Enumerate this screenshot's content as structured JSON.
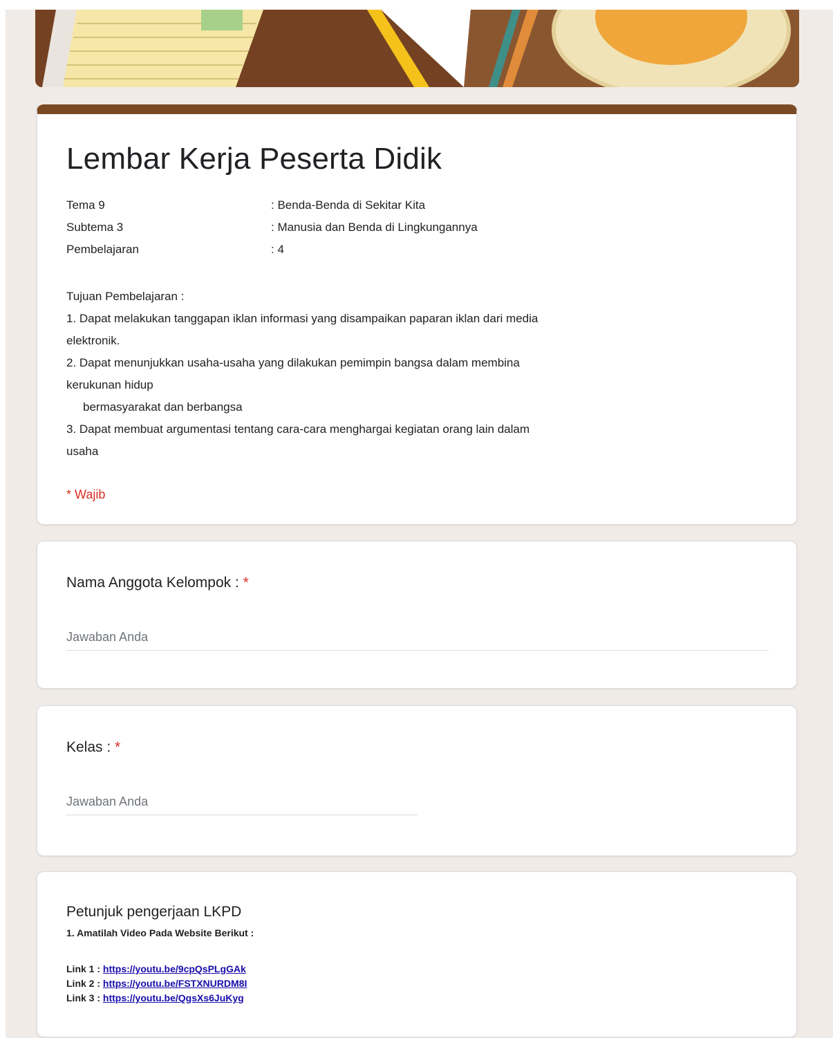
{
  "form": {
    "title": "Lembar Kerja Peserta Didik",
    "meta": [
      {
        "key": "Tema 9",
        "value": ": Benda-Benda di Sekitar Kita"
      },
      {
        "key": "Subtema 3",
        "value": ": Manusia dan Benda di Lingkungannya"
      },
      {
        "key": "Pembelajaran",
        "value": ": 4"
      }
    ],
    "description": {
      "heading": "Tujuan Pembelajaran          :",
      "lines": [
        "1. Dapat melakukan tanggapan iklan informasi yang disampaikan paparan iklan dari media",
        "elektronik.",
        "2. Dapat menunjukkan usaha-usaha yang dilakukan pemimpin bangsa dalam membina",
        "kerukunan hidup",
        "bermasyarakat dan berbangsa",
        "3. Dapat membuat argumentasi tentang cara-cara menghargai kegiatan orang lain dalam",
        "usaha"
      ]
    },
    "required_note": "* Wajib"
  },
  "questions": [
    {
      "title": "Nama Anggota Kelompok : ",
      "required_mark": "*",
      "placeholder": "Jawaban Anda"
    },
    {
      "title": "Kelas : ",
      "required_mark": "*",
      "placeholder": "Jawaban Anda"
    }
  ],
  "instructions": {
    "title": "Petunjuk pengerjaan LKPD",
    "subtitle": "1. Amatilah Video Pada Website Berikut :",
    "links": [
      {
        "label": "Link 1 : ",
        "url": "https://youtu.be/9cpQsPLgGAk"
      },
      {
        "label": "Link 2 : ",
        "url": "https://youtu.be/FSTXNURDM8I"
      },
      {
        "label": "Link 3 : ",
        "url": "https://youtu.be/QgsXs6JuKyg"
      }
    ]
  },
  "colors": {
    "accent": "#7b4a23",
    "required": "#d93025",
    "link": "#1a0dab",
    "background": "#f0ebe7"
  }
}
